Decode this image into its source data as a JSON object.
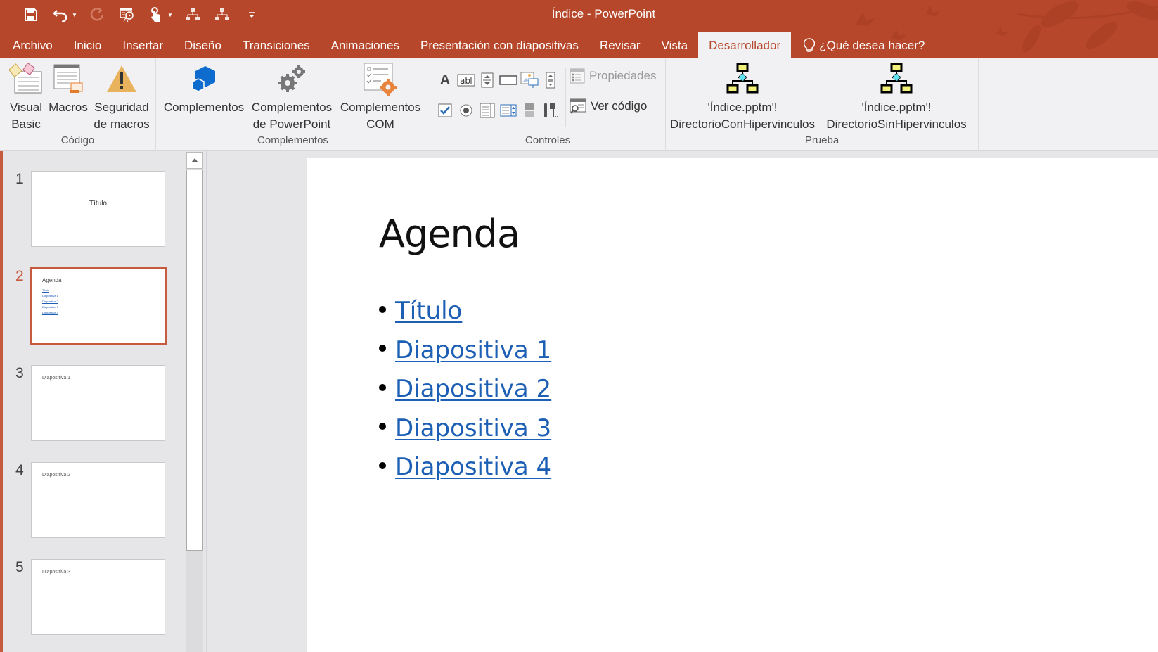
{
  "window": {
    "title": "Índice - PowerPoint",
    "accent_color": "#b7472a"
  },
  "quick_access": [
    {
      "name": "save-icon"
    },
    {
      "name": "undo-icon",
      "has_dropdown": true
    },
    {
      "name": "redo-icon",
      "disabled": true
    },
    {
      "name": "start-slideshow-icon"
    },
    {
      "name": "touch-mode-icon",
      "has_dropdown": true
    },
    {
      "name": "macro-directory-con-icon"
    },
    {
      "name": "macro-directory-sin-icon"
    },
    {
      "name": "customize-qat-icon"
    }
  ],
  "tabs": [
    {
      "label": "Archivo"
    },
    {
      "label": "Inicio"
    },
    {
      "label": "Insertar"
    },
    {
      "label": "Diseño"
    },
    {
      "label": "Transiciones"
    },
    {
      "label": "Animaciones"
    },
    {
      "label": "Presentación con diapositivas"
    },
    {
      "label": "Revisar"
    },
    {
      "label": "Vista"
    },
    {
      "label": "Desarrollador",
      "active": true
    }
  ],
  "tell_me": {
    "label": "¿Qué desea hacer?"
  },
  "ribbon": {
    "groups": {
      "codigo": {
        "label": "Código",
        "buttons": [
          {
            "line1": "Visual",
            "line2": "Basic"
          },
          {
            "line1": "Macros",
            "line2": ""
          },
          {
            "line1": "Seguridad",
            "line2": "de macros"
          }
        ]
      },
      "complementos": {
        "label": "Complementos",
        "buttons": [
          {
            "line1": "Complementos",
            "line2": ""
          },
          {
            "line1": "Complementos",
            "line2": "de PowerPoint"
          },
          {
            "line1": "Complementos",
            "line2": "COM"
          }
        ]
      },
      "controles": {
        "label": "Controles",
        "propiedades": "Propiedades",
        "ver_codigo": "Ver código"
      },
      "prueba": {
        "label": "Prueba",
        "buttons": [
          {
            "line1": "'Índice.pptm'!",
            "line2": "DirectorioConHipervinculos"
          },
          {
            "line1": "'Índice.pptm'!",
            "line2": "DirectorioSinHipervinculos"
          }
        ]
      }
    }
  },
  "thumbnails": [
    {
      "number": "1",
      "title": "Título",
      "selected": false
    },
    {
      "number": "2",
      "title": "Agenda",
      "selected": true,
      "items": [
        "Título",
        "Diapositiva 1",
        "Diapositiva 2",
        "Diapositiva 3",
        "Diapositiva 4"
      ]
    },
    {
      "number": "3",
      "title": "Diapositiva 1",
      "selected": false
    },
    {
      "number": "4",
      "title": "Diapositiva 2",
      "selected": false
    },
    {
      "number": "5",
      "title": "Diapositiva 3",
      "selected": false
    }
  ],
  "slide": {
    "title": "Agenda",
    "bullets": [
      "Título",
      "Diapositiva 1",
      "Diapositiva 2",
      "Diapositiva 3",
      "Diapositiva 4"
    ],
    "link_color": "#1c5fb5"
  }
}
